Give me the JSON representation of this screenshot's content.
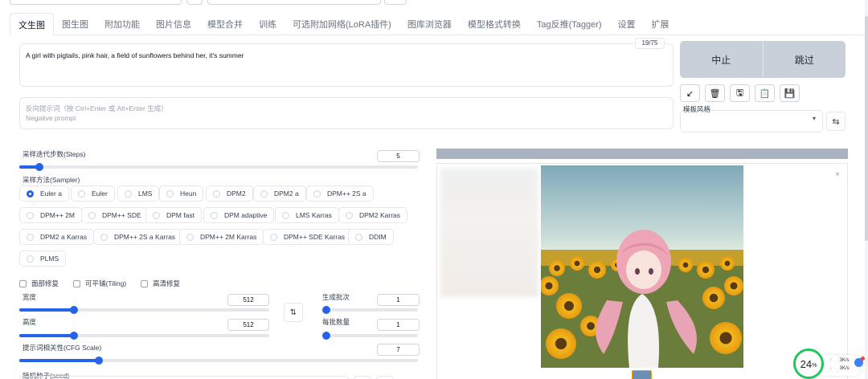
{
  "tabs": [
    "文生图",
    "图生图",
    "附加功能",
    "图片信息",
    "模型合并",
    "训练",
    "可选附加网络(LoRA插件)",
    "图库浏览器",
    "模型格式转换",
    "Tag反推(Tagger)",
    "设置",
    "扩展"
  ],
  "prompt": {
    "text": "A girl with pigtails, pink hair, a field of sunflowers behind her, it's summer",
    "counter": "19/75"
  },
  "negative": {
    "placeholder_line1": "反向提示词（按 Ctrl+Enter 或 Alt+Enter 生成）",
    "placeholder_line2": "Negative prompt"
  },
  "actions": {
    "interrupt": "中止",
    "skip": "跳过"
  },
  "tools": {
    "icons": [
      "arrow-icon",
      "trash-icon",
      "save-style-icon",
      "clipboard-icon",
      "floppy-icon"
    ],
    "glyphs": [
      "↙",
      "🗑",
      "🖫",
      "📋",
      "💾"
    ]
  },
  "styles": {
    "label": "模板风格",
    "swap_glyph": "⇆"
  },
  "steps": {
    "label": "采样迭代步数(Steps)",
    "value": "5",
    "fraction": 0.05
  },
  "sampler": {
    "label": "采样方法(Sampler)",
    "selected": "Euler a",
    "options": [
      "Euler a",
      "Euler",
      "LMS",
      "Heun",
      "DPM2",
      "DPM2 a",
      "DPM++ 2S a",
      "DPM++ 2M",
      "DPM++ SDE",
      "DPM fast",
      "DPM adaptive",
      "LMS Karras",
      "DPM2 Karras",
      "DPM2 a Karras",
      "DPM++ 2S a Karras",
      "DPM++ 2M Karras",
      "DPM++ SDE Karras",
      "DDIM",
      "PLMS"
    ]
  },
  "checks": [
    "面部修复",
    "可平铺(Tiling)",
    "高清修复"
  ],
  "width": {
    "label": "宽度",
    "value": "512",
    "fraction": 0.22
  },
  "height": {
    "label": "高度",
    "value": "512",
    "fraction": 0.22
  },
  "batch_count": {
    "label": "生成批次",
    "value": "1",
    "fraction": 0.0
  },
  "batch_size": {
    "label": "每批数量",
    "value": "1",
    "fraction": 0.0
  },
  "cfg": {
    "label": "提示词相关性(CFG Scale)",
    "value": "7",
    "fraction": 0.2
  },
  "seed": {
    "label": "随机种子(seed)"
  },
  "swap_dims_glyph": "⇅",
  "gallery": {
    "close_glyph": "×"
  },
  "netmon": {
    "percent": "24",
    "percent_unit": "%",
    "up": "3K/s",
    "down": "3K/s",
    "up_arrow": "↑",
    "down_arrow": "↓"
  }
}
